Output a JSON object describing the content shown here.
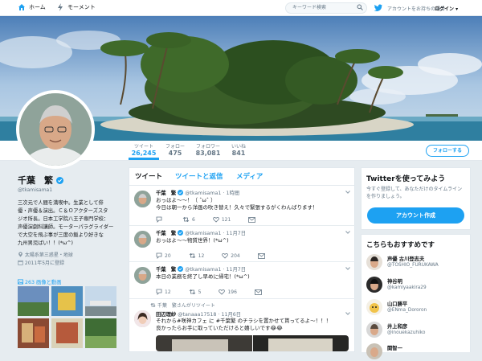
{
  "nav": {
    "home": "ホーム",
    "moments": "モーメント"
  },
  "search": {
    "placeholder": "キーワード検索"
  },
  "account": {
    "have_account": "アカウントをお持ちの場合",
    "login": "ログイン ▾"
  },
  "stats": [
    {
      "label": "ツイート",
      "value": "26,245"
    },
    {
      "label": "フォロー",
      "value": "475"
    },
    {
      "label": "フォロワー",
      "value": "83,081"
    },
    {
      "label": "いいね",
      "value": "841"
    }
  ],
  "follow_button": "フォローする",
  "profile": {
    "name": "千葉　繁",
    "handle": "@tkamisama1",
    "bio": [
      "三次元で人間を満喫中。生業として俳",
      "優・声優＆演出。Ｃ＆Ｏアクターズスタ",
      "ジオ所長。日本工学院八王子専門学校：",
      "声優演劇科講師。モーターパラグライダー",
      "で大空を飛ぶ事が三度の飯より好きな",
      "九州男児ばい！！(*ω^)"
    ],
    "location": "太陽系第三惑星・地球",
    "joined": "2011年5月に登録"
  },
  "media_title": "263 画像と動画",
  "timeline": {
    "tabs": [
      "ツイート",
      "ツイートと返信",
      "メディア"
    ],
    "tweets": [
      {
        "name": "千葉　繁",
        "handle": "@tkamisama1",
        "time": "1時間",
        "lines": [
          "おっはよ〜〜！（ ˆωˆ ）",
          "今日は朝一から洋画の吹き替え！久々で緊張するがくわんばります！"
        ],
        "replies": "",
        "retweets": "6",
        "likes": "121"
      },
      {
        "name": "千葉　繁",
        "handle": "@tkamisama1",
        "time": "11月7日",
        "lines": [
          "おっはよ〜〜物質世界！(*ω^)"
        ],
        "replies": "20",
        "retweets": "12",
        "likes": "204"
      },
      {
        "name": "千葉　繁",
        "handle": "@tkamisama1",
        "time": "11月7日",
        "lines": [
          "本日の業務を終了し早めに帰宅！(*ω^)"
        ],
        "replies": "12",
        "retweets": "5",
        "likes": "196"
      },
      {
        "retweet_note": "千葉　繁さんがリツイート",
        "name": "田辺理紗",
        "handle": "@tanaaa17518",
        "time": "11月6日",
        "lines": [
          "それから#咲神カフェ に #千葉繁 のチラシを置かせて貰ってるよ〜！！！",
          "良かったらお手に取っていただけると嬉しいです😂😂"
        ]
      }
    ]
  },
  "signup": {
    "title": "Twitterを使ってみよう",
    "subtitle": "今すぐ登録して、あなただけのタイムラインを作りましょう。",
    "button": "アカウント作成"
  },
  "recommend": {
    "title": "こちらもおすすめです",
    "users": [
      {
        "name": "声優 古川登志夫",
        "handle": "@TOSHIO_FURUKAWA"
      },
      {
        "name": "神谷明",
        "handle": "@kamiyaakira29"
      },
      {
        "name": "山口勝平",
        "handle": "@ENma_Dororon"
      },
      {
        "name": "井上和彦",
        "handle": "@inouekazuhiko"
      },
      {
        "name": "関智一",
        "handle": ""
      }
    ]
  },
  "colors": {
    "accent": "#1da1f2",
    "bg": "#e6ecf0"
  }
}
